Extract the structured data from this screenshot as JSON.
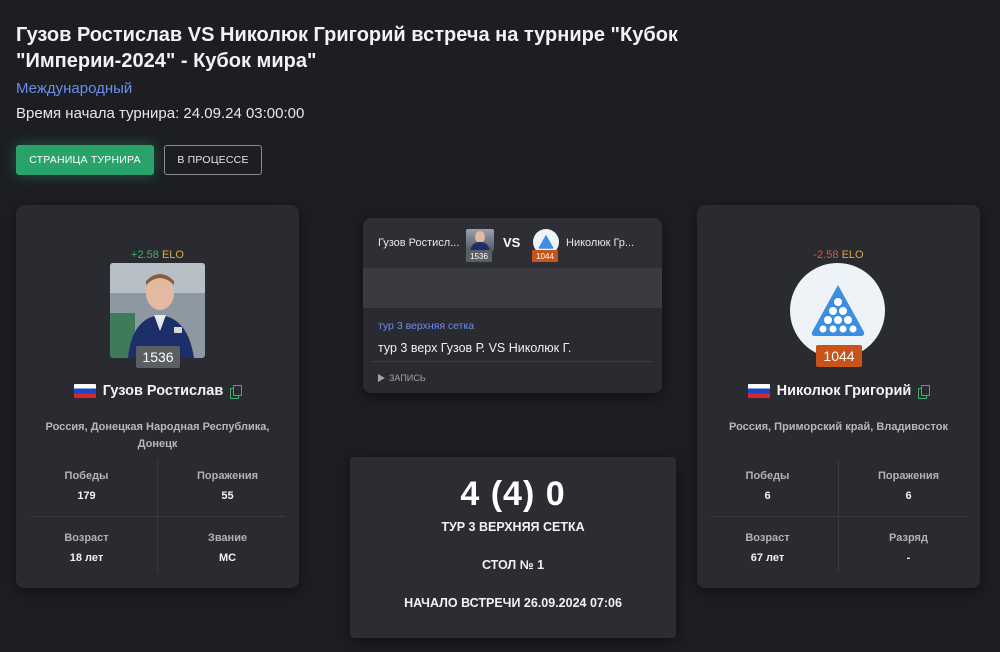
{
  "header": {
    "title_line1": "Гузов Ростислав VS Николюк Григорий встреча на турнире \"Кубок",
    "title_line2": "\"Империи-2024\" - Кубок мира\"",
    "category_link": "Международный",
    "start_time": "Время начала турнира: 24.09.24 03:00:00"
  },
  "buttons": {
    "tournament_page": "Страница турнира",
    "status": "В процессе"
  },
  "colors": {
    "accent_green": "#2aa36b",
    "link_blue": "#6d8cf0",
    "elo_positive": "#38b36b",
    "elo_negative": "#e2533f",
    "rating_orange": "#c8531b"
  },
  "player1": {
    "elo_change": "+2.58",
    "elo_unit": "ELO",
    "rating": "1536",
    "name": "Гузов Ростислав",
    "flag": "russia-flag-icon",
    "location": "Россия, Донецкая Народная Республика, Донецк",
    "stats": [
      {
        "label": "Победы",
        "value": "179"
      },
      {
        "label": "Поражения",
        "value": "55"
      },
      {
        "label": "Возраст",
        "value": "18 лет"
      },
      {
        "label": "Звание",
        "value": "МС"
      }
    ]
  },
  "player2": {
    "elo_change": "-2.58",
    "elo_unit": "ELO",
    "rating": "1044",
    "name": "Николюк Григорий",
    "flag": "russia-flag-icon",
    "location": "Россия, Приморский край, Владивосток",
    "stats": [
      {
        "label": "Победы",
        "value": "6"
      },
      {
        "label": "Поражения",
        "value": "6"
      },
      {
        "label": "Возраст",
        "value": "67 лет"
      },
      {
        "label": "Разряд",
        "value": "-"
      }
    ]
  },
  "match_card": {
    "player1_short": "Гузов Ростисл...",
    "player2_short": "Николюк Гр...",
    "vs": "VS",
    "player1_rating": "1536",
    "player2_rating": "1044",
    "round_link": "тур 3 верхняя сетка",
    "description": "тур 3 верх Гузов Р. VS Николюк Г.",
    "record_label": "запись"
  },
  "score_card": {
    "score": "4 (4) 0",
    "round": "тур 3 верхняя сетка",
    "table": "стол № 1",
    "start": "начало встречи 26.09.2024 07:06"
  }
}
